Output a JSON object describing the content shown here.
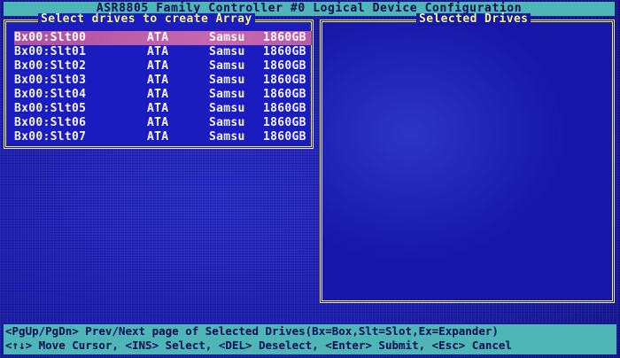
{
  "header": {
    "title": "ASR8805 Family Controller #0 Logical Device Configuration"
  },
  "drive_panel": {
    "title": "Select drives to create Array",
    "drives": [
      {
        "id": "Bx00:Slt00",
        "type": "ATA",
        "vendor": "Samsu",
        "size": "1860GB",
        "selected": true
      },
      {
        "id": "Bx00:Slt01",
        "type": "ATA",
        "vendor": "Samsu",
        "size": "1860GB",
        "selected": false
      },
      {
        "id": "Bx00:Slt02",
        "type": "ATA",
        "vendor": "Samsu",
        "size": "1860GB",
        "selected": false
      },
      {
        "id": "Bx00:Slt03",
        "type": "ATA",
        "vendor": "Samsu",
        "size": "1860GB",
        "selected": false
      },
      {
        "id": "Bx00:Slt04",
        "type": "ATA",
        "vendor": "Samsu",
        "size": "1860GB",
        "selected": false
      },
      {
        "id": "Bx00:Slt05",
        "type": "ATA",
        "vendor": "Samsu",
        "size": "1860GB",
        "selected": false
      },
      {
        "id": "Bx00:Slt06",
        "type": "ATA",
        "vendor": "Samsu",
        "size": "1860GB",
        "selected": false
      },
      {
        "id": "Bx00:Slt07",
        "type": "ATA",
        "vendor": "Samsu",
        "size": "1860GB",
        "selected": false
      }
    ]
  },
  "selected_panel": {
    "title": "Selected Drives"
  },
  "help": {
    "line1": "<PgUp/PgDn> Prev/Next page of Selected Drives(Bx=Box,Slt=Slot,Ex=Expander)",
    "line2": "<↑↓> Move Cursor, <INS> Select, <DEL> Deselect, <Enter> Submit, <Esc> Cancel"
  }
}
